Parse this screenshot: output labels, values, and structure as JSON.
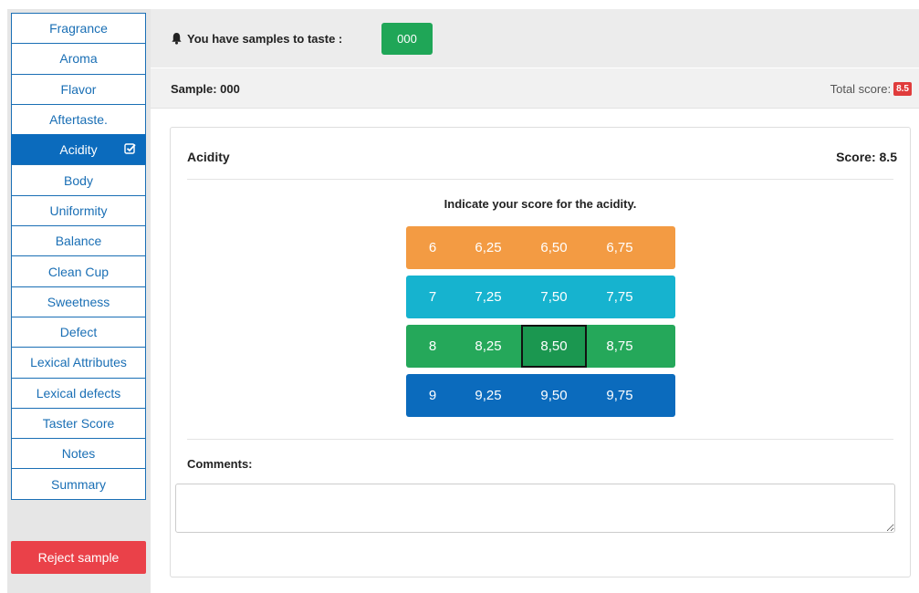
{
  "sidebar": {
    "items": [
      {
        "label": "Fragrance"
      },
      {
        "label": "Aroma"
      },
      {
        "label": "Flavor"
      },
      {
        "label": "Aftertaste."
      },
      {
        "label": "Acidity",
        "active": true
      },
      {
        "label": "Body"
      },
      {
        "label": "Uniformity"
      },
      {
        "label": "Balance"
      },
      {
        "label": "Clean Cup"
      },
      {
        "label": "Sweetness"
      },
      {
        "label": "Defect"
      },
      {
        "label": "Lexical Attributes"
      },
      {
        "label": "Lexical defects"
      },
      {
        "label": "Taster Score"
      },
      {
        "label": "Notes"
      },
      {
        "label": "Summary"
      }
    ],
    "reject_label": "Reject sample"
  },
  "header": {
    "samples_message": "You have samples to taste :",
    "sample_badge": "000",
    "sample_label": "Sample: 000",
    "total_label": "Total score:",
    "total_value": "8.5"
  },
  "panel": {
    "title": "Acidity",
    "score": "Score: 8.5",
    "instruction": "Indicate your score for the acidity.",
    "rows": [
      {
        "values": [
          "6",
          "6,25",
          "6,50",
          "6,75"
        ],
        "color": "#f39b43"
      },
      {
        "values": [
          "7",
          "7,25",
          "7,50",
          "7,75"
        ],
        "color": "#16b3cf"
      },
      {
        "values": [
          "8",
          "8,25",
          "8,50",
          "8,75"
        ],
        "color": "#25a85a"
      },
      {
        "values": [
          "9",
          "9,25",
          "9,50",
          "9,75"
        ],
        "color": "#0b6bbd"
      }
    ],
    "selected_value": "8,50",
    "comments_label": "Comments:",
    "comments_value": ""
  },
  "colors": {
    "accent": "#0b6bbd",
    "reject": "#ea4149",
    "badge_green": "#1fa657",
    "total_badge": "#e03c3c"
  }
}
